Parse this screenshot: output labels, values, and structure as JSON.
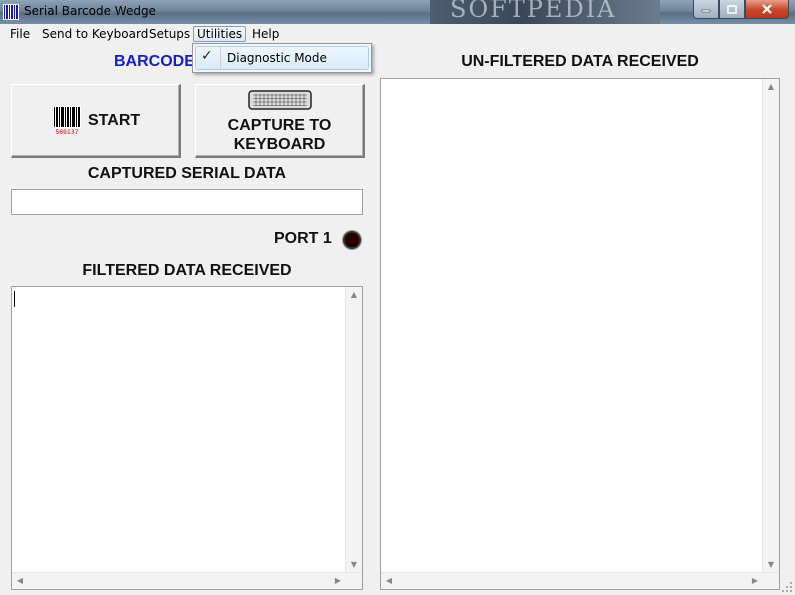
{
  "window": {
    "title": "Serial Barcode Wedge",
    "watermark": "SOFTPEDIA"
  },
  "menu": {
    "items": [
      "File",
      "Send to Keyboard",
      "Setups",
      "Utilities",
      "Help"
    ],
    "active": "Utilities"
  },
  "utilities_menu": {
    "items": [
      {
        "label": "Diagnostic Mode",
        "checked": true,
        "check_glyph": "✓"
      }
    ]
  },
  "left": {
    "heading_partial": "BARCODE",
    "start_button": "START",
    "barcode_number": "569137",
    "capture_button_line1": "CAPTURE TO",
    "capture_button_line2": "KEYBOARD",
    "captured_heading": "CAPTURED SERIAL DATA",
    "captured_value": "",
    "port_label": "PORT 1",
    "filtered_heading": "FILTERED DATA RECEIVED",
    "filtered_value": ""
  },
  "right": {
    "unfiltered_heading": "UN-FILTERED DATA RECEIVED",
    "unfiltered_value": ""
  },
  "colors": {
    "accent_blue": "#1520c8",
    "led": "#2a0000",
    "close_button": "#c9452b"
  },
  "icons": {
    "app": "barcode-icon",
    "start": "barcode-icon",
    "capture": "keyboard-icon",
    "port": "led-indicator-icon"
  }
}
